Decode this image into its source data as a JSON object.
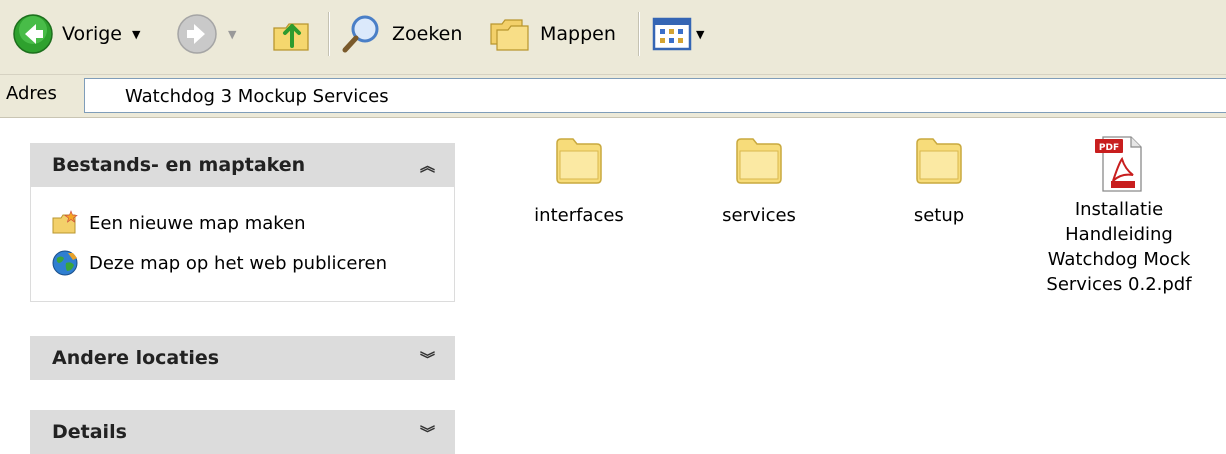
{
  "toolbar": {
    "back_label": "Vorige",
    "search_label": "Zoeken",
    "folders_label": "Mappen"
  },
  "address": {
    "label": "Adres",
    "value": "Watchdog 3 Mockup Services"
  },
  "tasks_pane": {
    "title": "Bestands- en maptaken",
    "items": [
      {
        "label": "Een nieuwe map maken",
        "icon": "new-folder-icon"
      },
      {
        "label": "Deze map op het web publiceren",
        "icon": "globe-icon"
      }
    ]
  },
  "other_places": {
    "title": "Andere locaties"
  },
  "details": {
    "title": "Details"
  },
  "files": [
    {
      "name": "interfaces",
      "type": "folder"
    },
    {
      "name": "services",
      "type": "folder"
    },
    {
      "name": "setup",
      "type": "folder"
    },
    {
      "name": "Installatie Handleiding Watchdog Mock Services 0.2.pdf",
      "type": "pdf",
      "label_lines": [
        "Installatie",
        "Handleiding",
        "Watchdog Mock",
        "Services 0.2.pdf"
      ]
    }
  ]
}
